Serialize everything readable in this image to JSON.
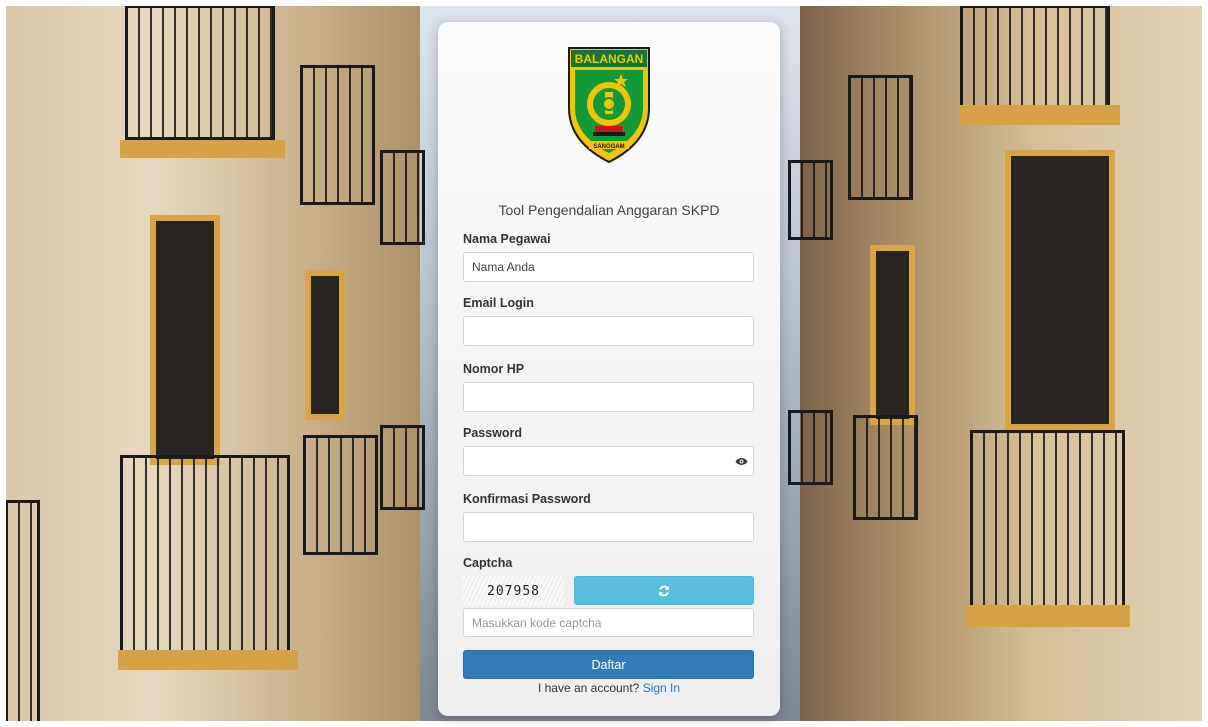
{
  "header": {
    "logo_text": "BALANGAN",
    "logo_motto": "SANGGAM",
    "app_title": "Tool Pengendalian Anggaran SKPD"
  },
  "form": {
    "nama": {
      "label": "Nama Pegawai",
      "value": "Nama Anda"
    },
    "email": {
      "label": "Email Login",
      "value": ""
    },
    "hp": {
      "label": "Nomor HP",
      "value": ""
    },
    "password": {
      "label": "Password",
      "value": ""
    },
    "confirm": {
      "label": "Konfirmasi Password",
      "value": ""
    },
    "captcha": {
      "label": "Captcha",
      "code": "207958",
      "placeholder": "Masukkan kode captcha"
    },
    "submit_label": "Daftar"
  },
  "footer": {
    "prompt": "I have an account?",
    "link": "Sign In"
  },
  "icons": {
    "eye": "eye-icon",
    "refresh": "refresh-icon"
  },
  "colors": {
    "primary": "#337ab7",
    "info": "#5bc0de"
  }
}
